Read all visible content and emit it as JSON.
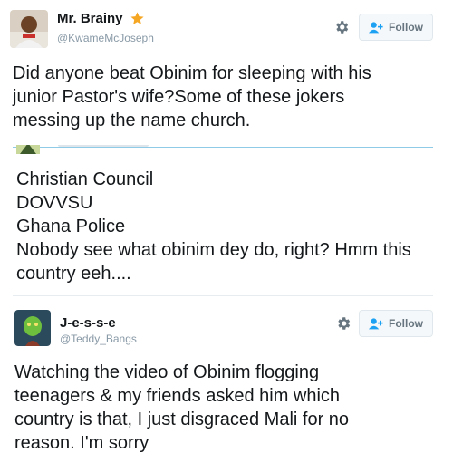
{
  "tweets": [
    {
      "display_name": "Mr. Brainy",
      "badge_icon": "star-icon",
      "handle": "@KwameMcJoseph",
      "follow_label": "Follow",
      "text": "Did anyone beat Obinim for sleeping with his junior Pastor's wife?Some of these jokers messing up the name church."
    },
    {
      "text": "Christian Council\nDOVVSU\nGhana Police\nNobody see what obinim dey do, right? Hmm this country eeh...."
    },
    {
      "display_name": "J-e-s-s-e",
      "handle": "@Teddy_Bangs",
      "follow_label": "Follow",
      "text": "Watching the video of Obinim flogging teenagers & my friends asked him which country is that, I just disgraced Mali for no reason. I'm sorry"
    }
  ],
  "colors": {
    "badge": "#f5a623",
    "handle": "#8899a6",
    "follow_icon": "#1da1f2",
    "divider_blue": "#8fcbe6"
  }
}
